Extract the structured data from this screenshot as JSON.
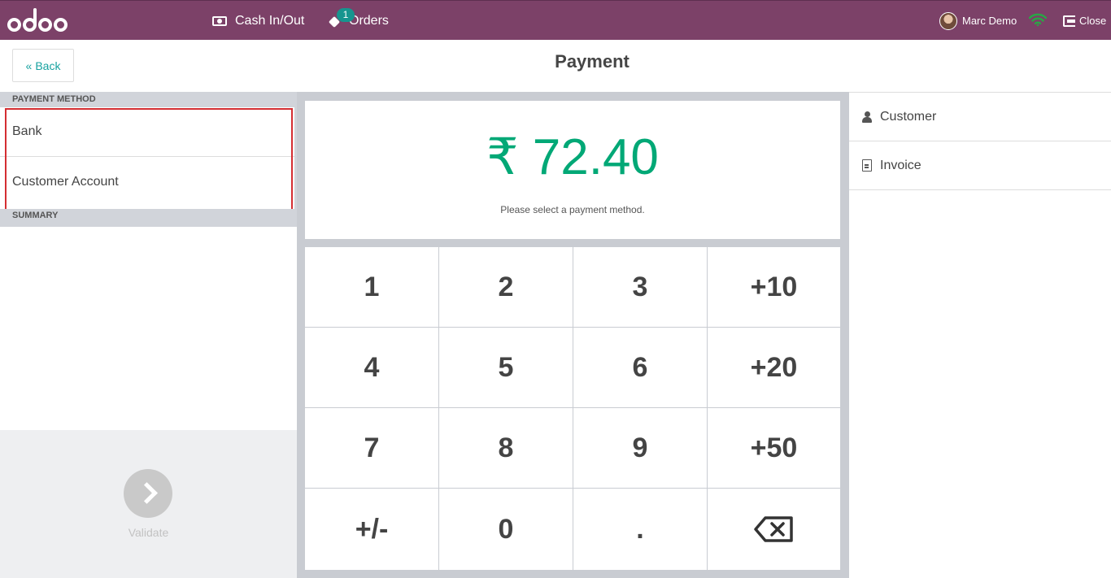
{
  "navbar": {
    "logo_text": "odoo",
    "cash_label": "Cash In/Out",
    "orders_label": "Orders",
    "orders_badge": "1",
    "user_name": "Marc Demo",
    "close_label": "Close",
    "colors": {
      "navbar_bg": "#7c4168",
      "badge_bg": "#16958f",
      "wifi": "#28a745"
    },
    "icons": [
      "money-icon",
      "tag-icon",
      "avatar",
      "wifi-icon",
      "sign-out-icon"
    ]
  },
  "header": {
    "back_label": "Back",
    "title": "Payment"
  },
  "left": {
    "payment_method_title": "Payment Method",
    "payment_methods": [
      "Bank",
      "Customer Account"
    ],
    "summary_title": "Summary",
    "validate_label": "Validate"
  },
  "payment": {
    "amount": "₹ 72.40",
    "hint": "Please select a payment method.",
    "amount_color": "#02a876"
  },
  "keypad": {
    "keys": [
      "1",
      "2",
      "3",
      "+10",
      "4",
      "5",
      "6",
      "+20",
      "7",
      "8",
      "9",
      "+50",
      "+/-",
      "0",
      ".",
      "backspace"
    ]
  },
  "right": {
    "customer_label": "Customer",
    "invoice_label": "Invoice"
  }
}
